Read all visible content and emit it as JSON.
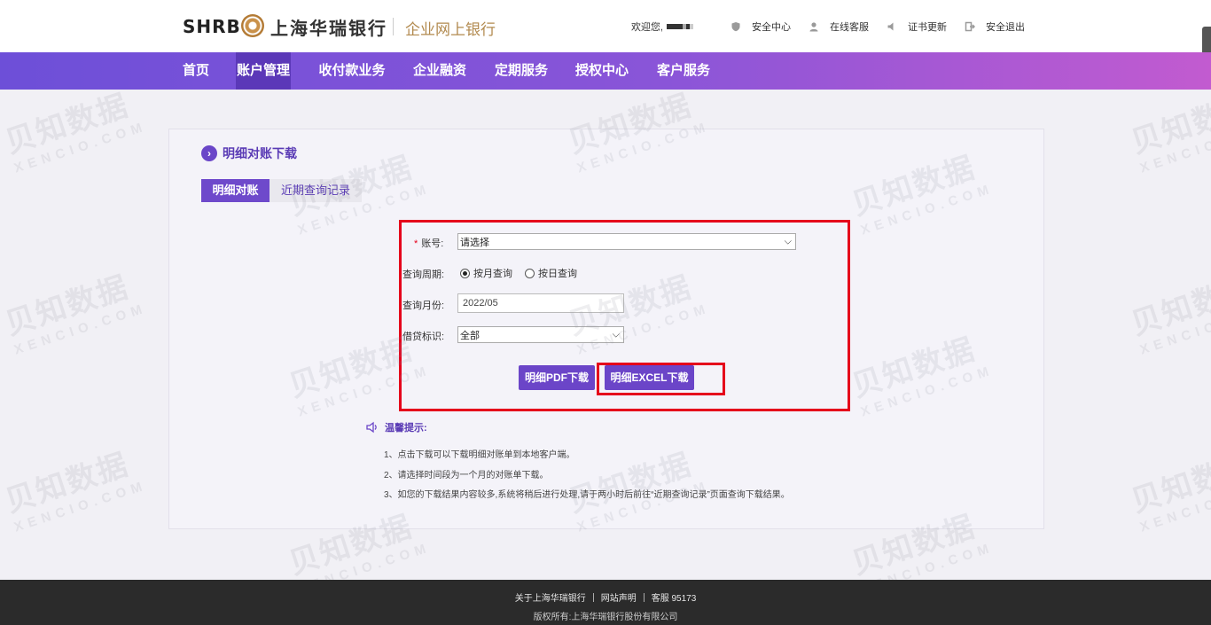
{
  "header": {
    "brand_latin": "SHRB",
    "brand_cn": "上海华瑞银行",
    "portal_name": "企业网上银行",
    "welcome": "欢迎您,",
    "links": [
      {
        "label": "安全中心",
        "icon": "shield-icon"
      },
      {
        "label": "在线客服",
        "icon": "user-service-icon"
      },
      {
        "label": "证书更新",
        "icon": "speaker-icon"
      },
      {
        "label": "安全退出",
        "icon": "logout-icon"
      }
    ]
  },
  "nav": {
    "items": [
      "首页",
      "账户管理",
      "收付款业务",
      "企业融资",
      "定期服务",
      "授权中心",
      "客户服务"
    ],
    "active": "账户管理"
  },
  "panel": {
    "title": "明细对账下载",
    "tabs": [
      "明细对账",
      "近期查询记录"
    ]
  },
  "form": {
    "account_label": "账号:",
    "account_value": "请选择",
    "period_label": "查询周期:",
    "period_options": [
      "按月查询",
      "按日查询"
    ],
    "period_selected": "按月查询",
    "month_label": "查询月份:",
    "month_value": "2022/05",
    "flag_label": "借贷标识:",
    "flag_value": "全部"
  },
  "buttons": {
    "pdf": "明细PDF下载",
    "excel": "明细EXCEL下载"
  },
  "tips": {
    "heading": "温馨提示:",
    "items": [
      "1、点击下载可以下载明细对账单到本地客户端。",
      "2、请选择时间段为一个月的对账单下载。",
      "3、如您的下载结果内容较多,系统将稍后进行处理,请于两小时后前往“近期查询记录”页面查询下载结果。"
    ]
  },
  "footer": {
    "links": [
      "关于上海华瑞银行",
      "网站声明",
      "客服 95173"
    ],
    "copyright": "版权所有:上海华瑞银行股份有限公司"
  },
  "watermark": {
    "cn": "贝知数据",
    "en": "XENCIO.COM"
  },
  "colors": {
    "brand_purple": "#6b45c8",
    "highlight_red": "#e5001b",
    "gold": "#b28a4f"
  }
}
